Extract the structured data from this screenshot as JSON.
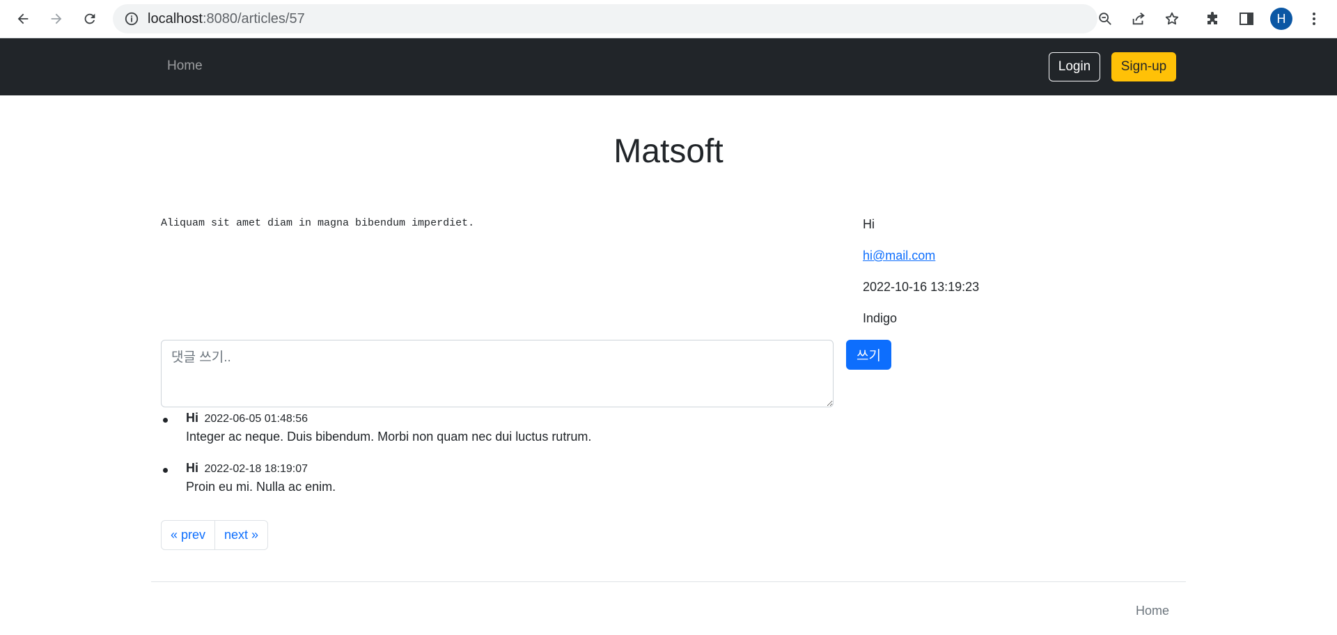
{
  "browser": {
    "url_host": "localhost",
    "url_path": ":8080/articles/57",
    "profile_initial": "H",
    "icons": [
      "back-icon",
      "forward-icon",
      "reload-icon",
      "info-icon",
      "zoom-out-icon",
      "share-icon",
      "star-icon",
      "puzzle-icon",
      "side-panel-icon",
      "kebab-menu-icon"
    ]
  },
  "navbar": {
    "home_label": "Home",
    "login_label": "Login",
    "signup_label": "Sign-up"
  },
  "page": {
    "title": "Matsoft"
  },
  "article": {
    "content": "Aliquam sit amet diam in magna bibendum imperdiet.",
    "author": "Hi",
    "email": "hi@mail.com",
    "created_at": "2022-10-16 13:19:23",
    "hashtag": "Indigo"
  },
  "comment_form": {
    "placeholder": "댓글 쓰기..",
    "submit_label": "쓰기"
  },
  "comments": [
    {
      "author": "Hi",
      "date": "2022-06-05 01:48:56",
      "text": "Integer ac neque. Duis bibendum. Morbi non quam nec dui luctus rutrum."
    },
    {
      "author": "Hi",
      "date": "2022-02-18 18:19:07",
      "text": "Proin eu mi. Nulla ac enim."
    }
  ],
  "pagination": {
    "prev_label": "« prev",
    "next_label": "next »"
  },
  "footer": {
    "home_label": "Home"
  },
  "colors": {
    "navbar_bg": "#212529",
    "primary": "#0d6efd",
    "warning": "#ffc107",
    "avatar": "#0b57a4"
  }
}
